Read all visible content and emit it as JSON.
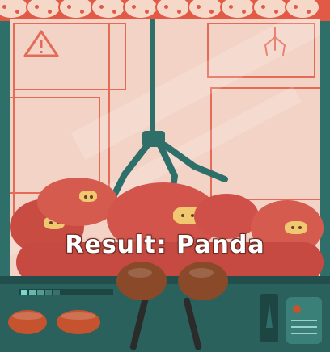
{
  "result": {
    "text": "Result: Panda"
  },
  "icons": {
    "warning": "warning-triangle-icon",
    "claw": "claw-icon"
  },
  "colors": {
    "cabinet": "#2f6f6a",
    "canopy": "#e25a45",
    "glass": "#f2d3c6",
    "prize": "#d4564c",
    "button": "#c4532e",
    "text": "#ffffff"
  }
}
